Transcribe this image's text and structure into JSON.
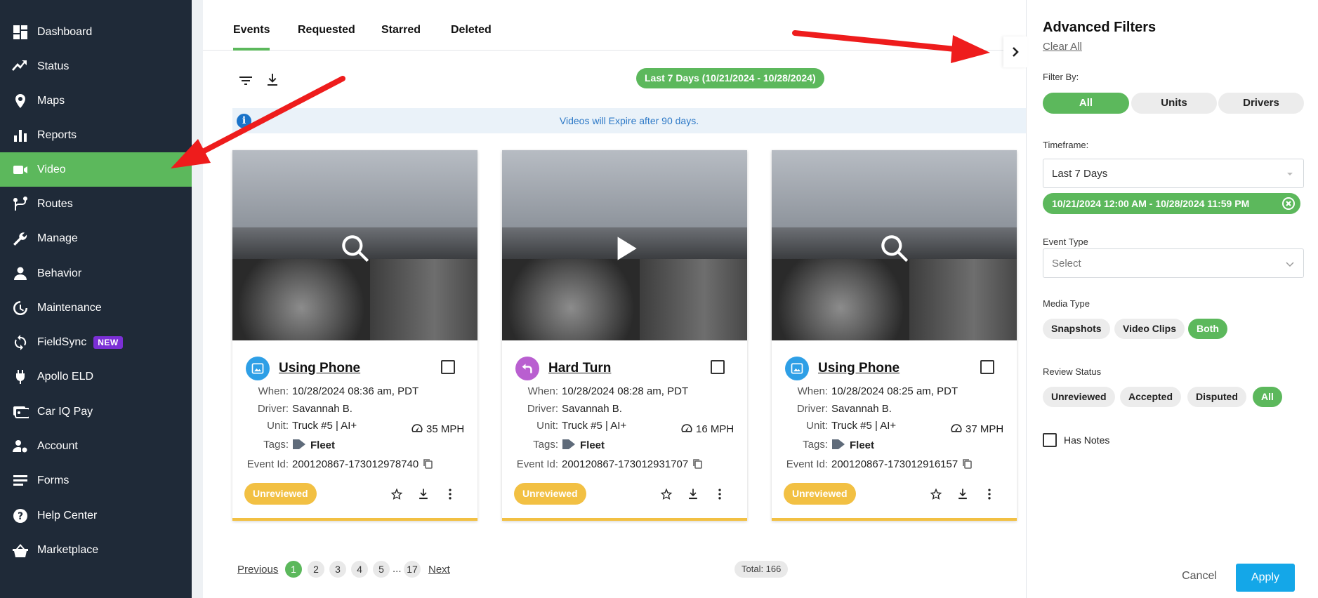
{
  "sidebar": {
    "items": [
      {
        "label": "Dashboard",
        "icon": "dashboard-icon"
      },
      {
        "label": "Status",
        "icon": "status-icon"
      },
      {
        "label": "Maps",
        "icon": "map-pin-icon"
      },
      {
        "label": "Reports",
        "icon": "bar-chart-icon"
      },
      {
        "label": "Video",
        "icon": "video-camera-icon",
        "active": true
      },
      {
        "label": "Routes",
        "icon": "routes-icon"
      },
      {
        "label": "Manage",
        "icon": "wrench-icon"
      },
      {
        "label": "Behavior",
        "icon": "person-icon"
      },
      {
        "label": "Maintenance",
        "icon": "maintenance-icon"
      },
      {
        "label": "FieldSync",
        "icon": "sync-icon",
        "badge": "NEW"
      },
      {
        "label": "Apollo ELD",
        "icon": "plug-icon"
      },
      {
        "label": "Car IQ Pay",
        "icon": "payment-icon"
      },
      {
        "label": "Account",
        "icon": "account-gear-icon"
      },
      {
        "label": "Forms",
        "icon": "forms-icon"
      },
      {
        "label": "Help Center",
        "icon": "help-icon"
      },
      {
        "label": "Marketplace",
        "icon": "basket-icon"
      }
    ],
    "active_color": "#5cb85c",
    "badge_color": "#7b2fd6"
  },
  "tabs": [
    {
      "label": "Events",
      "active": true
    },
    {
      "label": "Requested"
    },
    {
      "label": "Starred"
    },
    {
      "label": "Deleted"
    }
  ],
  "toolbar": {
    "filter_icon": "filter-icon",
    "download_icon": "download-icon",
    "date_range": "Last 7 Days (10/21/2024 - 10/28/2024)"
  },
  "info": {
    "icon_glyph": "i",
    "text": "Videos will Expire after 90 days."
  },
  "labels": {
    "when": "When:",
    "driver": "Driver:",
    "unit": "Unit:",
    "tags": "Tags:",
    "event_id": "Event Id:"
  },
  "cards": [
    {
      "title": "Using Phone",
      "event_icon": "image-icon",
      "icon_color": "#2e9fe6",
      "media_icon": "magnify-icon",
      "when": "10/28/2024 08:36 am, PDT",
      "driver": "Savannah B.",
      "unit": "Truck #5 | AI+",
      "speed": "35 MPH",
      "tag": "Fleet",
      "event_id": "200120867-173012978740",
      "status": "Unreviewed"
    },
    {
      "title": "Hard Turn",
      "event_icon": "turn-left-icon",
      "icon_color": "#b95fd0",
      "media_icon": "play-icon",
      "when": "10/28/2024 08:28 am, PDT",
      "driver": "Savannah B.",
      "unit": "Truck #5 | AI+",
      "speed": "16 MPH",
      "tag": "Fleet",
      "event_id": "200120867-173012931707",
      "status": "Unreviewed"
    },
    {
      "title": "Using Phone",
      "event_icon": "image-icon",
      "icon_color": "#2e9fe6",
      "media_icon": "magnify-icon",
      "when": "10/28/2024 08:25 am, PDT",
      "driver": "Savannah B.",
      "unit": "Truck #5 | AI+",
      "speed": "37 MPH",
      "tag": "Fleet",
      "event_id": "200120867-173012916157",
      "status": "Unreviewed"
    }
  ],
  "pagination": {
    "previous": "Previous",
    "next": "Next",
    "pages": [
      "1",
      "2",
      "3",
      "4",
      "5"
    ],
    "ellipsis": "...",
    "last": "17",
    "current": "1",
    "total": "Total: 166"
  },
  "filters": {
    "title": "Advanced Filters",
    "clear_all": "Clear All",
    "filter_by_label": "Filter By:",
    "filter_by_options": [
      "All",
      "Units",
      "Drivers"
    ],
    "filter_by_selected": "All",
    "timeframe_label": "Timeframe:",
    "timeframe_value": "Last 7 Days",
    "timeframe_range": "10/21/2024 12:00 AM - 10/28/2024 11:59 PM",
    "event_type_label": "Event Type",
    "event_type_placeholder": "Select",
    "media_type_label": "Media Type",
    "media_type_options": [
      "Snapshots",
      "Video Clips",
      "Both"
    ],
    "media_type_selected": "Both",
    "review_status_label": "Review Status",
    "review_status_options": [
      "Unreviewed",
      "Accepted",
      "Disputed",
      "All"
    ],
    "review_status_selected": "All",
    "has_notes_label": "Has Notes",
    "cancel": "Cancel",
    "apply": "Apply"
  },
  "colors": {
    "accent_green": "#5cb85c",
    "status_yellow": "#f2c043",
    "apply_blue": "#14a7e8",
    "annotation_red": "#ee1c1c"
  }
}
